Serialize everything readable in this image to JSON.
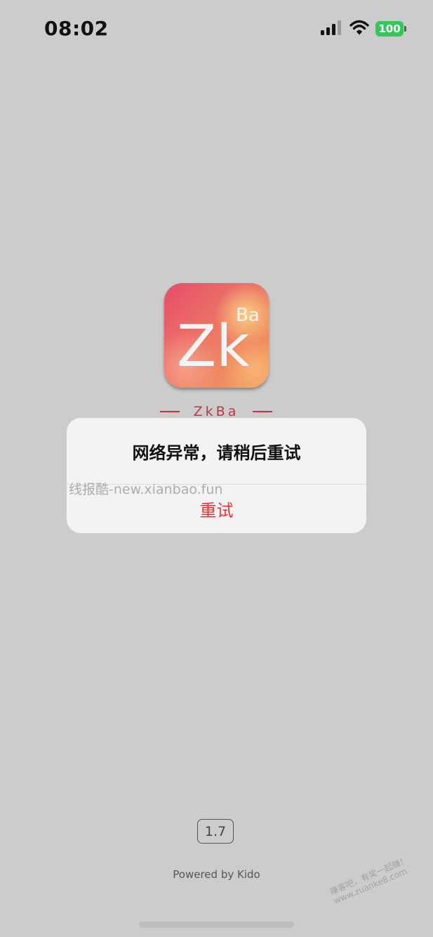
{
  "status_bar": {
    "time": "08:02",
    "battery": "100",
    "icons": [
      "cellular-signal-icon",
      "wifi-icon",
      "battery-icon"
    ]
  },
  "app": {
    "icon_text_main": "Zk",
    "icon_text_sup": "Ba",
    "name": "ZkBa"
  },
  "dialog": {
    "message": "网络异常，请稍后重试",
    "retry_label": "重试"
  },
  "watermark": {
    "text": "线报酷-new.xianbao.fun",
    "corner_line1": "赚客吧，有奖一起赚！",
    "corner_line2": "www.zuanke8.com"
  },
  "footer": {
    "version": "1.7",
    "powered_by": "Powered by Kido"
  },
  "colors": {
    "background": "#cccccc",
    "accent_red": "#e2383f",
    "brand": "#c2334a",
    "battery_green": "#34c759"
  }
}
